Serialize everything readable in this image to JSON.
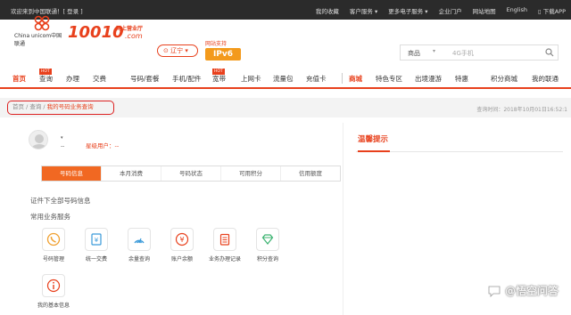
{
  "topbar": {
    "welcome": "欢迎来到中国联通！[ 登录 ]",
    "links": [
      "我的收藏",
      "客户服务 ▾",
      "更多电子服务 ▾",
      "企业门户",
      "网站地图",
      "English",
      "下载APP"
    ]
  },
  "header": {
    "logo_text": "China unicom中国联通",
    "brand_number": "10010",
    "brand_sub": "网上营业厅",
    "brand_url": ".com",
    "province": "辽宁",
    "ipv6_caption": "网站支持",
    "ipv6_badge": "IPv6",
    "search_category": "商品",
    "search_placeholder": "4G手机"
  },
  "nav": {
    "items": [
      "首页",
      "查询",
      "办理",
      "交费",
      "号码/套餐",
      "手机/配件",
      "宽带",
      "上网卡",
      "流量包",
      "充值卡",
      "商城",
      "特色专区",
      "出境漫游",
      "特惠",
      "积分商城",
      "我的联通"
    ],
    "hot_label": "HOT"
  },
  "breadcrumb": {
    "home": "首页",
    "sep": " / ",
    "query": "查询",
    "current": "我的号码业务查询",
    "query_time": "查询时间：2018年10月01日16:52:1"
  },
  "user": {
    "name": "--",
    "star_label": "星级用户：--"
  },
  "tabs": [
    "号码信息",
    "本月消费",
    "号码状态",
    "可用积分",
    "信用额度"
  ],
  "section1": "证件下全部号码信息",
  "section2": "常用业务服务",
  "services": [
    {
      "label": "号码管理",
      "icon": "phone-icon"
    },
    {
      "label": "统一交费",
      "icon": "payment-icon"
    },
    {
      "label": "余量查询",
      "icon": "signal-icon"
    },
    {
      "label": "账户余额",
      "icon": "yen-icon"
    },
    {
      "label": "业务办理记录",
      "icon": "clipboard-icon"
    },
    {
      "label": "积分查询",
      "icon": "diamond-icon"
    },
    {
      "label": "我的基本信息",
      "icon": "info-icon"
    }
  ],
  "right": {
    "title": "温馨提示"
  },
  "watermark": "@悟空问答",
  "colors": {
    "accent": "#e8401c",
    "tab_active": "#f16822",
    "topbar": "#2b2b2b",
    "highlight_box": "#dd2222"
  }
}
